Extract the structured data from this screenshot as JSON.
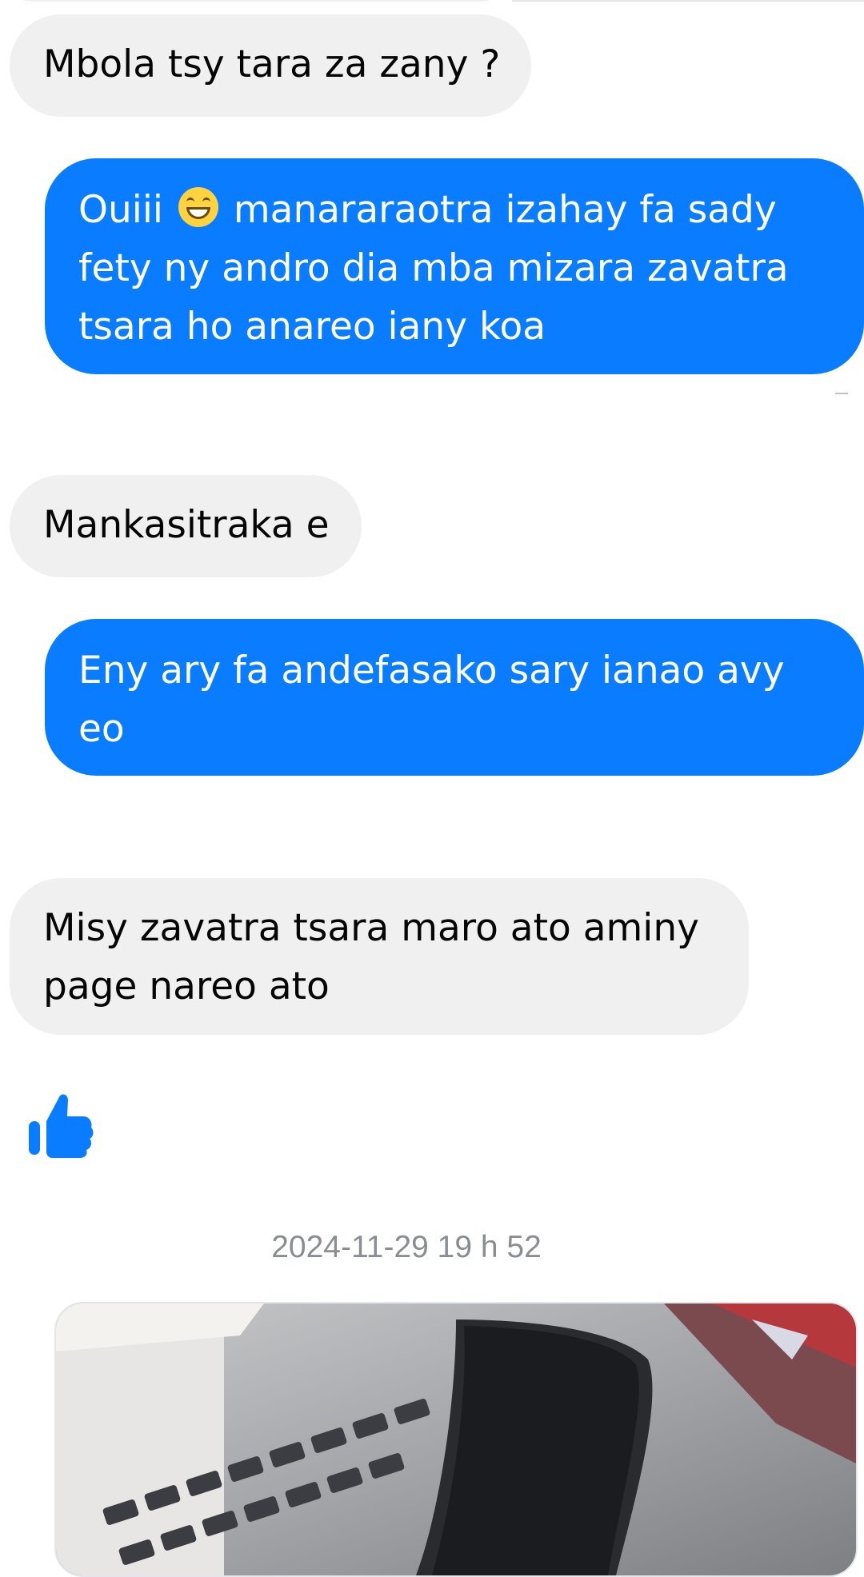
{
  "conversation": {
    "messages": [
      {
        "direction": "incoming",
        "text": "Mbola tsy tara za zany ?"
      },
      {
        "direction": "outgoing",
        "text_before_emoji": "Ouiii",
        "emoji": "grinning-face",
        "text_after_emoji": "manararaotra izahay fa sady fety ny andro dia mba mizara zavatra tsara ho anareo iany koa"
      },
      {
        "direction": "incoming",
        "text": "Mankasitraka e"
      },
      {
        "direction": "outgoing",
        "text": "Eny ary fa andefasako sary ianao avy eo"
      },
      {
        "direction": "incoming",
        "text": "Misy zavatra tsara maro ato aminy page nareo ato"
      },
      {
        "direction": "incoming",
        "type": "like",
        "icon": "thumbs-up-icon"
      }
    ],
    "timestamp": "2024-11-29 19 h 52",
    "attachment": {
      "type": "photo",
      "icon": "photo-attachment"
    }
  },
  "colors": {
    "outgoing_bubble": "#0a7cff",
    "incoming_bubble": "#f0f0f0",
    "like": "#0a7cff"
  }
}
